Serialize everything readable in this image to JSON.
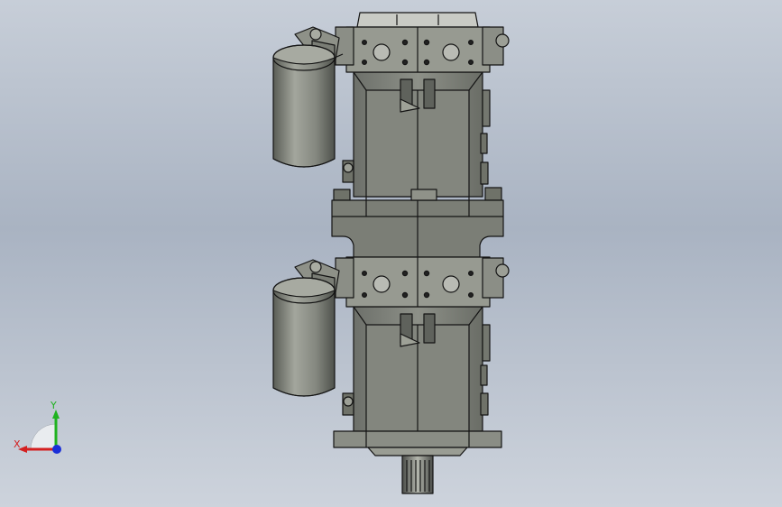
{
  "triad": {
    "x_label": "X",
    "y_label": "Y",
    "x_color": "#d42020",
    "y_color": "#1fb21f",
    "z_color": "#1a2fd8"
  },
  "model": {
    "body_color": "#7e817a",
    "edge_color": "#141414",
    "filter_color": "#8a8d85"
  }
}
